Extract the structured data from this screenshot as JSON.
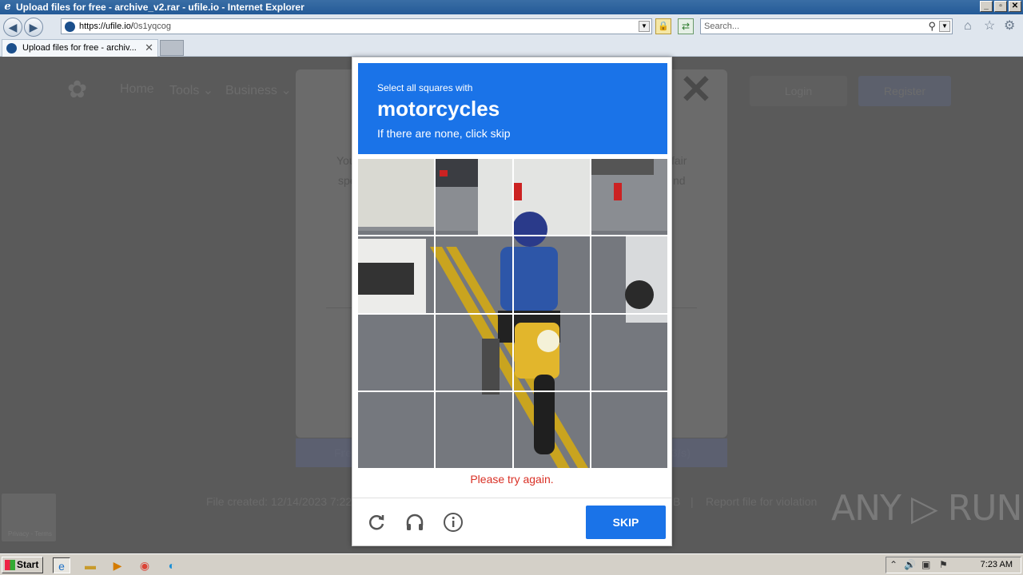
{
  "window": {
    "title": "Upload files for free - archive_v2.rar - ufile.io - Internet Explorer",
    "controls": [
      "_",
      "▫",
      "✕"
    ]
  },
  "address_bar": {
    "url_main": "https://ufile.io/",
    "url_path": "0s1yqcog",
    "search_placeholder": "Search..."
  },
  "tabs": [
    {
      "label": "Upload files for free - archiv...",
      "close": "✕"
    }
  ],
  "site": {
    "nav": [
      "Home",
      "Tools ⌄",
      "Business ⌄"
    ],
    "login": "Login",
    "register": "Register",
    "modal_fragments": {
      "left1": "You",
      "left2": "spe",
      "right1": "fair",
      "right2": "nd"
    },
    "download_left": "Fre",
    "download_right": "3/s)",
    "footer_created": "File created: 12/14/2023 7:22",
    "footer_size": "B",
    "footer_sep": "|",
    "footer_report": "Report file for violation",
    "recaptcha_badge": "Privacy - Terms",
    "watermark": "ANY ▷ RUN"
  },
  "captcha": {
    "instruction_line1": "Select all squares with",
    "target": "motorcycles",
    "instruction_line3": "If there are none, click skip",
    "error": "Please try again.",
    "skip_label": "SKIP",
    "grid_rows": 4,
    "grid_cols": 4,
    "icons": [
      "reload-icon",
      "audio-icon",
      "info-icon"
    ]
  },
  "taskbar": {
    "start_label": "Start",
    "clock": "7:23 AM"
  },
  "colors": {
    "captcha_blue": "#1a73e8",
    "error_red": "#d93025",
    "title_bar": "#245a97"
  }
}
